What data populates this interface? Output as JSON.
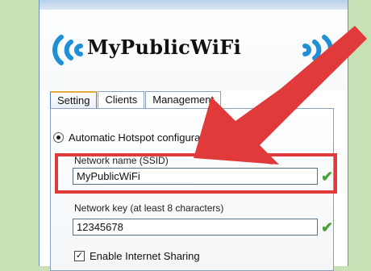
{
  "app": {
    "title": "MyPublicWiFi"
  },
  "tabs": [
    {
      "label": "Setting",
      "active": true
    },
    {
      "label": "Clients",
      "active": false
    },
    {
      "label": "Management",
      "active": false
    }
  ],
  "setting": {
    "automatic_hotspot_label": "Automatic Hotspot configuration",
    "network_name_label": "Network name (SSID)",
    "network_name_value": "MyPublicWiFi",
    "network_key_label": "Network key (at least 8 characters)",
    "network_key_value": "12345678",
    "enable_sharing_label": "Enable Internet Sharing"
  },
  "icons": {
    "wifi_left": "wifi-waves-icon",
    "wifi_right": "wifi-waves-icon",
    "check": "checkmark-icon",
    "arrow": "red-arrow-annotation"
  },
  "colors": {
    "background": "#c8e0b6",
    "annotation_red": "#e03a3a",
    "wifi_blue": "#1f8fd6",
    "check_green": "#4aa13a",
    "active_tab_accent": "#e3a93c"
  }
}
